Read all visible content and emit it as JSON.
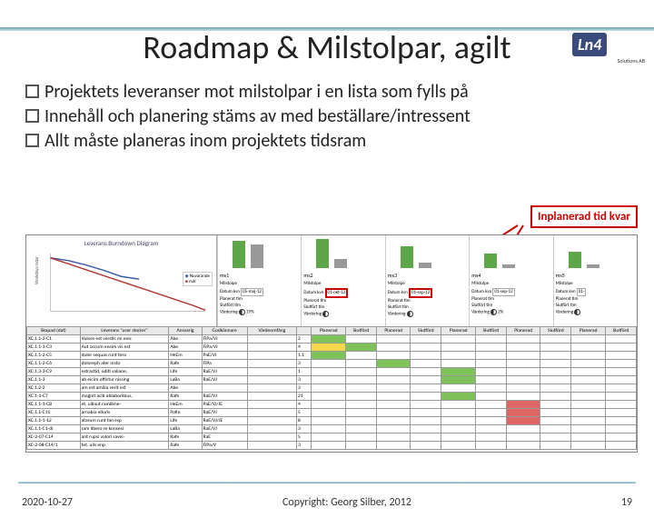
{
  "logo": {
    "main": "Ln4",
    "sub": "Solutions AB"
  },
  "title": "Roadmap & Milstolpar, agilt",
  "bullets": [
    "Projektets leveranser mot milstolpar i en lista som fylls på",
    "Innehåll och planering stäms av med beställare/intressent",
    "Allt måste planeras inom projektets tidsram"
  ],
  "annotation": "Inplanerad tid kvar",
  "burndown_title": "Leverans Burndown Diagram",
  "burndown_legend": [
    "Nuvarande",
    "mål"
  ],
  "burndown_axis": {
    "ylabel": "Workdays/sidor",
    "ymax": 160
  },
  "milestones": [
    {
      "name": "ms1",
      "label": "Milstolpe",
      "date": "05-maj-12",
      "datum": "Datum kvn",
      "planerat": "Planerat tim",
      "slutfort": "Slutfört tim",
      "vardering": "Värdering",
      "pct": "19%",
      "h1": 30,
      "h2": 26,
      "redbox": false
    },
    {
      "name": "ms2",
      "label": "Milstolpe",
      "date": "01-okt-12",
      "datum": "Datum kvn",
      "planerat": "Planerat tim",
      "slutfort": "Slutfört tim",
      "vardering": "Värdering",
      "pct": "",
      "h1": 32,
      "h2": 10,
      "redbox": true
    },
    {
      "name": "ms3",
      "label": "Milstolpe",
      "date": "01-sep-12",
      "datum": "Datum kvn",
      "planerat": "Planerat tim",
      "slutfort": "Slutfört tim",
      "vardering": "Värdering",
      "pct": "",
      "h1": 24,
      "h2": 6,
      "redbox": true
    },
    {
      "name": "ms4",
      "label": "Milstolpe",
      "date": "01-sep-12",
      "datum": "Datum kvn",
      "planerat": "Planerat tim",
      "slutfort": "Slutfört tim",
      "vardering": "Värdering",
      "pct": "2%",
      "h1": 16,
      "h2": 4,
      "redbox": false
    },
    {
      "name": "ms5",
      "label": "Milstolpe",
      "date": "01-",
      "datum": "Datum kvn",
      "planerat": "Planerat tim",
      "slutfort": "Slutfört tim",
      "vardering": "Värdering",
      "pct": "",
      "h1": 18,
      "h2": 4,
      "redbox": false
    }
  ],
  "table": {
    "headers": [
      "Skapad (dat)",
      "Leverans \"user stories\"",
      "Ansvarig",
      "Godkännare",
      "Värdeomfång",
      "",
      "Planerad",
      "Slutförd",
      "Planerad",
      "Slutförd",
      "Planerad",
      "Slutförd",
      "Planerad",
      "Slutförd",
      "Planerad",
      "Slutförd"
    ],
    "rows": [
      {
        "c": [
          "XC.1.1-2-C1",
          "Volore est verstis mi enic",
          "Abe",
          "FiPa/VJ",
          "",
          "2"
        ],
        "plan": [
          "g",
          "",
          "",
          "",
          "",
          "",
          "",
          "",
          "",
          ""
        ]
      },
      {
        "c": [
          "XC.1.1-3-C3",
          "Aut occum ensim vis est",
          "Abe",
          "FiPa/VJ",
          "",
          "4"
        ],
        "plan": [
          "y",
          "g",
          "",
          "",
          "",
          "",
          "",
          "",
          "",
          ""
        ]
      },
      {
        "c": [
          "XC.1.1-2-C5",
          "doler sequas runt tera",
          "HeEm",
          "PaE/VJ",
          "",
          "1.1"
        ],
        "plan": [
          "g",
          "",
          "",
          "",
          "",
          "",
          "",
          "",
          "",
          ""
        ]
      },
      {
        "c": [
          "XC.1.1-2-C6",
          "doloreph ater nisto",
          "Rafe",
          "FiPa",
          "",
          "3"
        ],
        "plan": [
          "",
          "",
          "g",
          "",
          "",
          "",
          "",
          "",
          "",
          ""
        ]
      },
      {
        "c": [
          "XC.1.3-3-C9",
          "estractid, oditi valiane,",
          "Life",
          "RaE/VJ",
          "",
          "1"
        ],
        "plan": [
          "",
          "",
          "",
          "",
          "g",
          "",
          "",
          "",
          "",
          ""
        ]
      },
      {
        "c": [
          "XC.1.1-3",
          "ab eicim offictur nissing",
          "LaBa",
          "RaE/VJ",
          "",
          "3"
        ],
        "plan": [
          "",
          "",
          "",
          "",
          "g",
          "",
          "",
          "",
          "",
          ""
        ]
      },
      {
        "c": [
          "XC.1.2-2",
          "am est amilia verit est",
          "Abe",
          "",
          "",
          "3"
        ],
        "plan": [
          "",
          "",
          "",
          "",
          "",
          "",
          "",
          "",
          "",
          ""
        ]
      },
      {
        "c": [
          "XC.1-1-C7",
          "magnit acib ablaboribius,",
          "Rafe",
          "RaE/VJ",
          "",
          "21"
        ],
        "plan": [
          "",
          "",
          "",
          "",
          "g",
          "",
          "",
          "",
          "",
          ""
        ]
      },
      {
        "c": [
          "XC.1.1-1-C8",
          "et, uillaut ramlikne-",
          "HeEm",
          "PaE/VJ/JE",
          "",
          "4"
        ],
        "plan": [
          "",
          "",
          "",
          "",
          "",
          "",
          "r",
          "",
          "",
          ""
        ]
      },
      {
        "c": [
          "XC.1.1-C11",
          "arnabia elloris",
          "Pafin",
          "RaE/VJ",
          "",
          "5"
        ],
        "plan": [
          "",
          "",
          "",
          "",
          "",
          "",
          "r",
          "",
          "",
          ""
        ]
      },
      {
        "c": [
          "XC.1.1-1-12",
          "atarum runt fan esp",
          "Life",
          "RaE/VJ/JE",
          "",
          "8"
        ],
        "plan": [
          "",
          "",
          "",
          "",
          "",
          "",
          "r",
          "",
          "",
          ""
        ]
      },
      {
        "c": [
          "XC.1.1-C1-di",
          "ram libero re konsesi",
          "LaBa",
          "RaE/VJ",
          "",
          "3"
        ],
        "plan": [
          "",
          "",
          "",
          "",
          "",
          "",
          "",
          "",
          "",
          ""
        ]
      },
      {
        "c": [
          "XC-2-07-C14",
          "ant rupsi volori savei-",
          "Rafe",
          "RaE",
          "",
          "5"
        ],
        "plan": [
          "",
          "",
          "",
          "",
          "",
          "",
          "",
          "",
          "",
          ""
        ]
      },
      {
        "c": [
          "XC-2-08-C14/1",
          "tet. ulis enp",
          "Rafe",
          "FiPa/V",
          "",
          "3"
        ],
        "plan": [
          "",
          "",
          "",
          "",
          "",
          "",
          "",
          "",
          "",
          ""
        ]
      }
    ]
  },
  "footer": {
    "date": "2020-10-27",
    "copyright": "Copyright: Georg Silber, 2012",
    "page": "19"
  },
  "chart_data": {
    "type": "line",
    "title": "Leverans Burndown Diagram",
    "ylabel": "Workdays/sidor",
    "ylim": [
      0,
      160
    ],
    "series": [
      {
        "name": "Nuvarande",
        "values": [
          145,
          138,
          128,
          116,
          102,
          96
        ]
      },
      {
        "name": "mål",
        "values": [
          145,
          130,
          115,
          100,
          85,
          70,
          55,
          40,
          25,
          10,
          0
        ]
      }
    ]
  }
}
